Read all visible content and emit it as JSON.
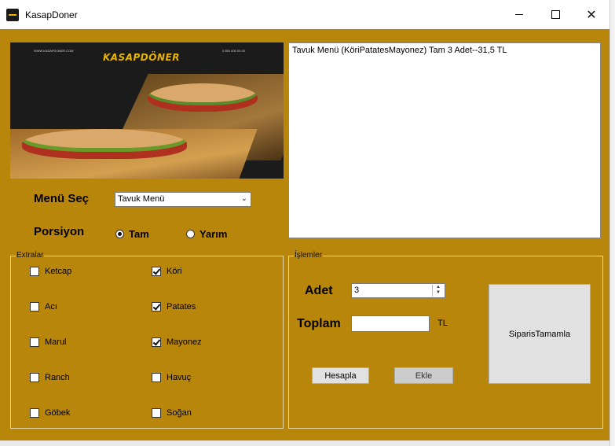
{
  "window": {
    "title": "KasapDoner"
  },
  "photo": {
    "logo": "KASAPDÖNER",
    "contact_left": "WWW.KASAPDONER.COM",
    "contact_right": "0 850 000 00 00"
  },
  "menu": {
    "menu_label": "Menü Seç",
    "menu_selected": "Tavuk Menü",
    "portion_label": "Porsiyon",
    "portion_options": [
      {
        "label": "Tam",
        "checked": true
      },
      {
        "label": "Yarım",
        "checked": false
      }
    ]
  },
  "output": {
    "text": "Tavuk Menü (KöriPatatesMayonez) Tam 3 Adet--31,5 TL"
  },
  "extras": {
    "title": "Extralar",
    "items": [
      {
        "label": "Ketcap",
        "checked": false
      },
      {
        "label": "Acı",
        "checked": false
      },
      {
        "label": "Marul",
        "checked": false
      },
      {
        "label": "Ranch",
        "checked": false
      },
      {
        "label": "Göbek",
        "checked": false
      },
      {
        "label": "Köri",
        "checked": true
      },
      {
        "label": "Patates",
        "checked": true
      },
      {
        "label": "Mayonez",
        "checked": true
      },
      {
        "label": "Havuç",
        "checked": false
      },
      {
        "label": "Soğan",
        "checked": false
      }
    ]
  },
  "operations": {
    "title": "İşlemler",
    "qty_label": "Adet",
    "qty_value": "3",
    "total_label": "Toplam",
    "total_value": "",
    "currency": "TL",
    "calc_button": "Hesapla",
    "add_button": "Ekle",
    "complete_button": "SiparisTamamla"
  }
}
